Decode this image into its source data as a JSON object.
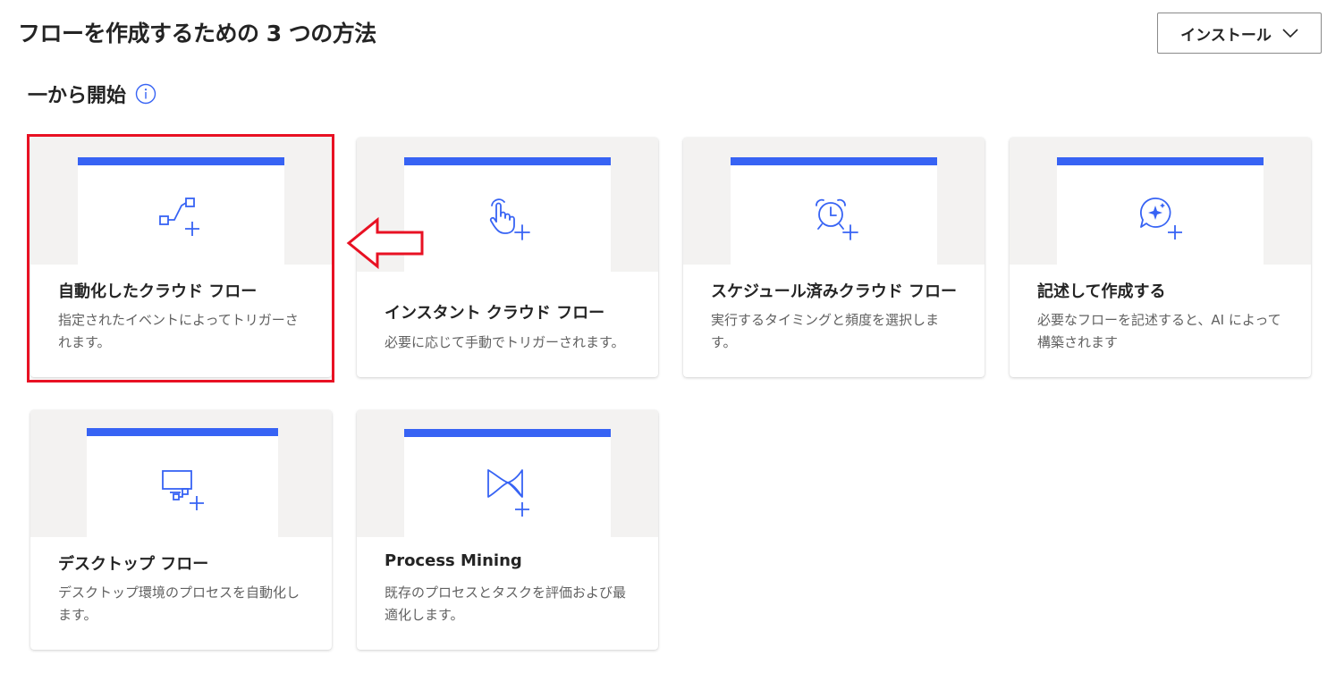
{
  "header": {
    "title": "フローを作成するための 3 つの方法",
    "install_label": "インストール"
  },
  "section": {
    "title": "一から開始"
  },
  "cards": [
    {
      "title": "自動化したクラウド フロー",
      "description": "指定されたイベントによってトリガーされます。",
      "icon": "automated-flow-icon"
    },
    {
      "title": "インスタント クラウド フロー",
      "description": "必要に応じて手動でトリガーされます。",
      "icon": "touch-hand-icon"
    },
    {
      "title": "スケジュール済みクラウド フロー",
      "description": "実行するタイミングと頻度を選択します。",
      "icon": "alarm-clock-icon"
    },
    {
      "title": "記述して作成する",
      "description": "必要なフローを記述すると、AI によって構築されます",
      "icon": "ai-chat-sparkle-icon"
    },
    {
      "title": "デスクトップ フロー",
      "description": "デスクトップ環境のプロセスを自動化します。",
      "icon": "desktop-flow-icon"
    },
    {
      "title": "Process Mining",
      "description": "既存のプロセスとタスクを評価および最適化します。",
      "icon": "process-mining-icon"
    }
  ],
  "colors": {
    "accent": "#3763f4",
    "highlight": "#e81123",
    "hero_background": "#f3f2f1",
    "description_text": "#616161"
  }
}
